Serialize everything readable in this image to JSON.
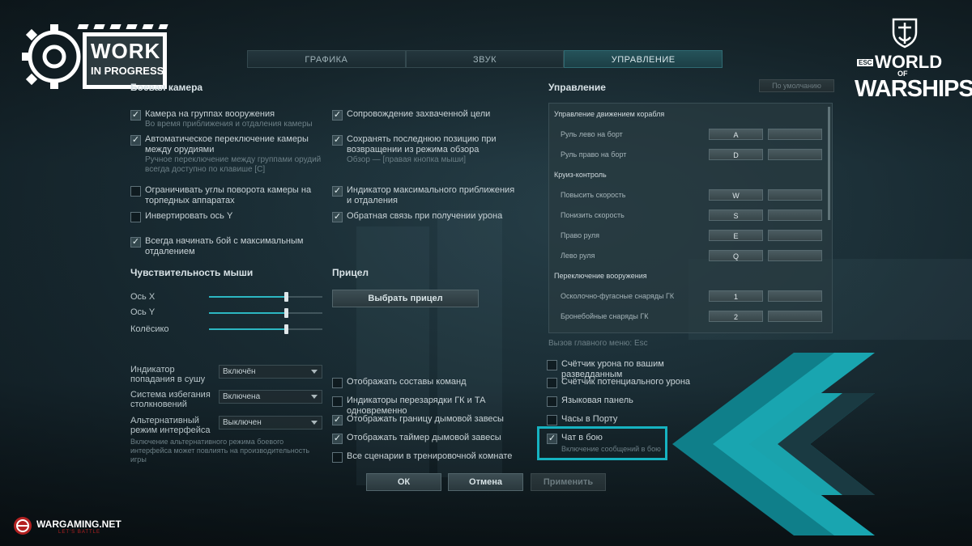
{
  "tabs": [
    "ГРАФИКА",
    "ЗВУК",
    "УПРАВЛЕНИЕ"
  ],
  "active_tab": 2,
  "battle_camera": {
    "title": "Боевая камера",
    "left": [
      {
        "label": "Камера на группах вооружения",
        "sub": "Во время приближения и отдаления камеры",
        "checked": true
      },
      {
        "label": "Автоматическое переключение камеры между орудиями",
        "sub": "Ручное переключение между группами орудий всегда доступно по клавише [C]",
        "checked": true
      },
      {
        "label": "Ограничивать углы поворота камеры на торпедных аппаратах",
        "sub": "",
        "checked": false
      },
      {
        "label": "Инвертировать ось Y",
        "sub": "",
        "checked": false
      },
      {
        "label": "Всегда начинать бой с максимальным отдалением",
        "sub": "",
        "checked": true
      }
    ],
    "right": [
      {
        "label": "Сопровождение захваченной цели",
        "sub": "",
        "checked": true
      },
      {
        "label": "Сохранять последнюю позицию при возвращении из режима обзора",
        "sub": "Обзор — [правая кнопка мыши]",
        "checked": true
      },
      {
        "label": "Индикатор максимального приближения и отдаления",
        "sub": "",
        "checked": true
      },
      {
        "label": "Обратная связь при получении урона",
        "sub": "",
        "checked": true
      }
    ]
  },
  "mouse": {
    "title": "Чувствительность мыши",
    "sliders": [
      {
        "label": "Ось X",
        "value": 0.68
      },
      {
        "label": "Ось Y",
        "value": 0.68
      },
      {
        "label": "Колёсико",
        "value": 0.68
      }
    ]
  },
  "sight": {
    "title": "Прицел",
    "button": "Выбрать прицел"
  },
  "dropdowns": [
    {
      "label": "Индикатор попадания в сушу",
      "value": "Включён"
    },
    {
      "label": "Система избегания столкновений",
      "value": "Включена"
    },
    {
      "label": "Альтернативный режим интерфейса",
      "value": "Выключен"
    }
  ],
  "alt_mode_note": "Включение альтернативного режима боевого интерфейса может повлиять на производительность игры",
  "middle_checks": [
    {
      "label": "Отображать составы команд",
      "checked": false
    },
    {
      "label": "Индикаторы перезарядки ГК и ТА одновременно",
      "checked": false
    },
    {
      "label": "Отображать границу дымовой завесы",
      "checked": true
    },
    {
      "label": "Отображать таймер дымовой завесы",
      "checked": true
    },
    {
      "label": "Все сценарии в тренировочной комнате",
      "checked": false
    }
  ],
  "controls": {
    "title": "Управление",
    "defaults_button": "По умолчанию",
    "groups": [
      {
        "title": "Управление движением корабля",
        "rows": [
          {
            "label": "Руль лево на борт",
            "key": "A"
          },
          {
            "label": "Руль право на борт",
            "key": "D"
          }
        ]
      },
      {
        "title": "Круиз-контроль",
        "rows": [
          {
            "label": "Повысить скорость",
            "key": "W"
          },
          {
            "label": "Понизить скорость",
            "key": "S"
          },
          {
            "label": "Право руля",
            "key": "E"
          },
          {
            "label": "Лево руля",
            "key": "Q"
          }
        ]
      },
      {
        "title": "Переключение вооружения",
        "rows": [
          {
            "label": "Осколочно-фугасные снаряды ГК",
            "key": "1"
          },
          {
            "label": "Бронебойные снаряды ГК",
            "key": "2"
          }
        ]
      }
    ],
    "main_menu_hint": "Вызов главного меню: Esc"
  },
  "right_checks": [
    {
      "label": "Счётчик урона по вашим разведданным",
      "sub": "",
      "checked": false
    },
    {
      "label": "Счётчик потенциального урона",
      "sub": "",
      "checked": false
    },
    {
      "label": "Языковая панель",
      "sub": "",
      "checked": false
    },
    {
      "label": "Часы в Порту",
      "sub": "",
      "checked": false
    },
    {
      "label": "Чат в бою",
      "sub": "Включение сообщений в бою",
      "checked": true
    }
  ],
  "footer_buttons": {
    "ok": "ОК",
    "cancel": "Отмена",
    "apply": "Применить"
  },
  "badges": {
    "work_line1": "WORK",
    "work_line2": "IN PROGRESS",
    "wows_esc": "ESC",
    "wows_world": "WORLD",
    "wows_of": "OF",
    "wows_warships": "WARSHIPS",
    "wg_name": "WARGAMING.NET",
    "wg_tagline": "LET'S BATTLE"
  },
  "colors": {
    "accent": "#16b3c1",
    "chevron_dark": "#0f7f8a",
    "chevron_light": "#22c4cf"
  }
}
